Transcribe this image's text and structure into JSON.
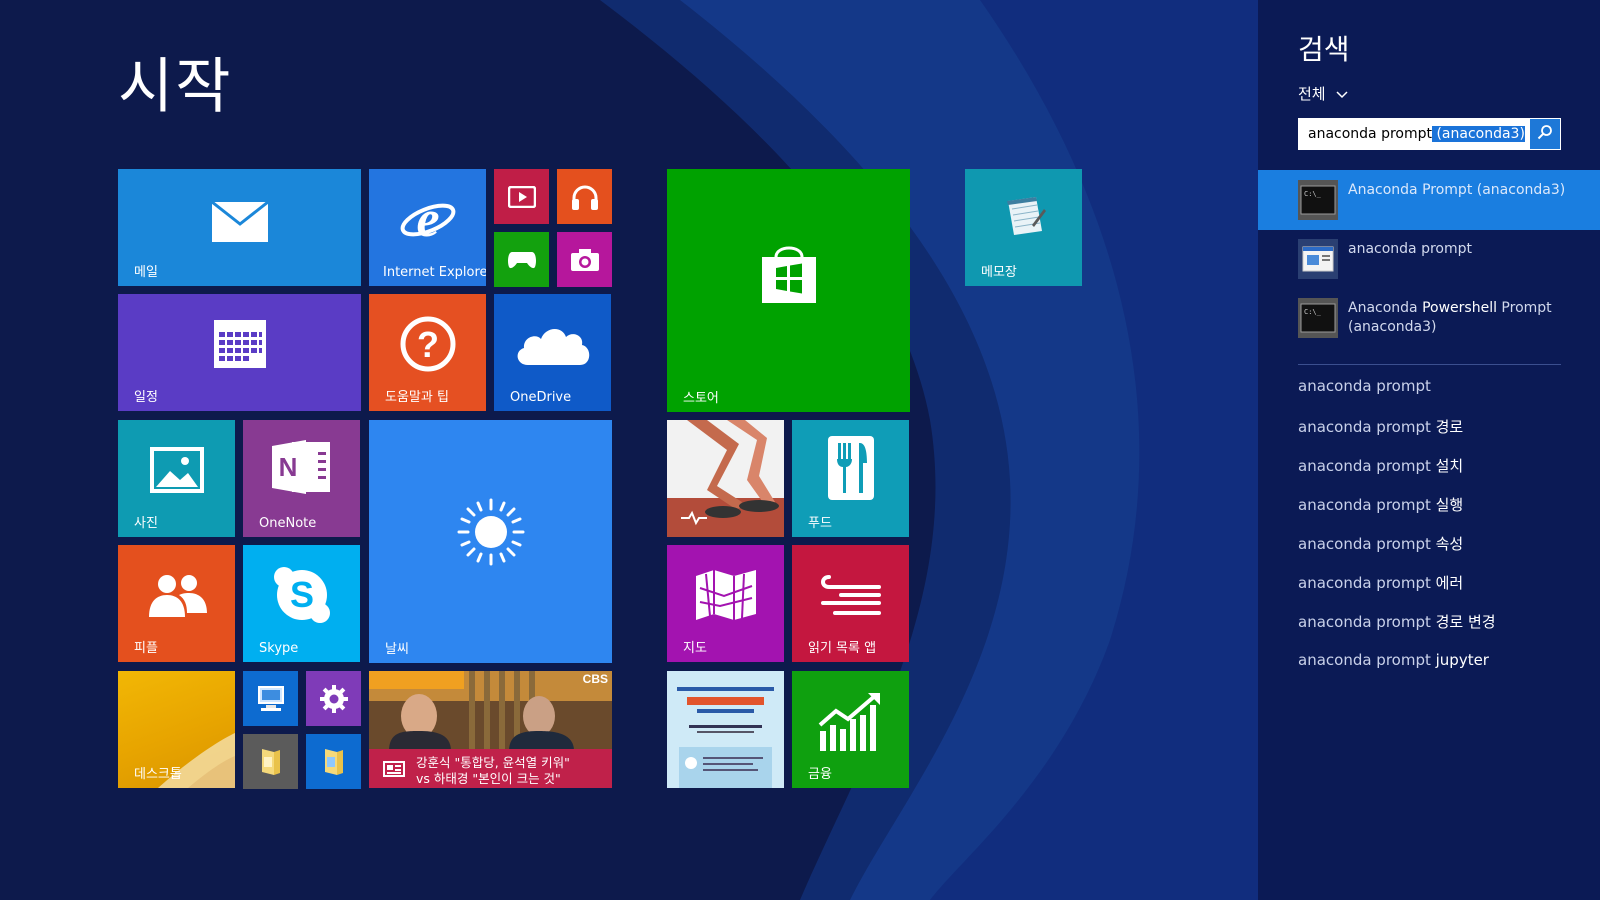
{
  "start": {
    "title": "시작"
  },
  "tiles": {
    "mail": "메일",
    "ie": "Internet Explorer",
    "calendar": "일정",
    "help": "도움말과 팁",
    "onedrive": "OneDrive",
    "photos": "사진",
    "onenote": "OneNote",
    "weather": "날씨",
    "people": "피플",
    "skype": "Skype",
    "desktop": "데스크톱",
    "store": "스토어",
    "food": "푸드",
    "maps": "지도",
    "reading_list": "읽기 목록 앱",
    "finance": "금융",
    "notepad": "메모장",
    "news": {
      "source": "CBS",
      "headline_line1": "강훈식 \"통합당, 윤석열 키워\"",
      "headline_line2": "vs 하태경 \"본인이 크는 것\""
    }
  },
  "search": {
    "title": "검색",
    "scope": "전체",
    "query_typed": "anaconda prompt",
    "query_selected": " (anaconda3)",
    "apps": [
      {
        "pre": "Anaconda Prompt (anaconda3)",
        "bold": "",
        "post": ""
      },
      {
        "pre": "anaconda prompt",
        "bold": "",
        "post": ""
      },
      {
        "pre": "Anaconda ",
        "bold": "Powershell",
        "post": " Prompt",
        "line2": "(anaconda3)"
      }
    ],
    "suggestions": [
      {
        "base": "anaconda prompt",
        "extra": ""
      },
      {
        "base": "anaconda prompt ",
        "extra": "경로"
      },
      {
        "base": "anaconda prompt ",
        "extra": "설치"
      },
      {
        "base": "anaconda prompt ",
        "extra": "실행"
      },
      {
        "base": "anaconda prompt ",
        "extra": "속성"
      },
      {
        "base": "anaconda prompt ",
        "extra": "에러"
      },
      {
        "base": "anaconda prompt ",
        "extra": "경로 변경"
      },
      {
        "base": "anaconda prompt ",
        "extra": "jupyter"
      }
    ]
  },
  "colors": {
    "background": "#0d1a4c",
    "search_pane": "#0b1a55",
    "accent": "#1a7ee0"
  }
}
